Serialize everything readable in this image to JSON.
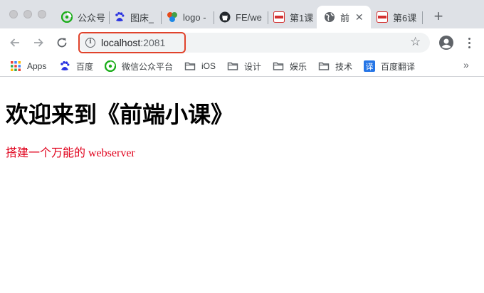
{
  "browser": {
    "tabs": [
      {
        "title": "公众号",
        "favicon": "wechat-icon"
      },
      {
        "title": "图床_",
        "favicon": "baidu-paw-icon"
      },
      {
        "title": "logo -",
        "favicon": "colorful-logo-icon"
      },
      {
        "title": "FE/we",
        "favicon": "github-icon"
      },
      {
        "title": "第1课",
        "favicon": "wii-icon"
      },
      {
        "title": "前端",
        "favicon": "globe-icon",
        "active": true
      },
      {
        "title": "第6课",
        "favicon": "wii-icon"
      }
    ],
    "new_tab_label": "+",
    "tab_close_label": "✕"
  },
  "toolbar": {
    "url_host": "localhost",
    "url_port": ":2081",
    "highlight_color": "#e0432c"
  },
  "bookmarks": [
    {
      "label": "Apps",
      "icon": "apps-grid-icon"
    },
    {
      "label": "百度",
      "icon": "baidu-paw-icon"
    },
    {
      "label": "微信公众平台",
      "icon": "wechat-icon"
    },
    {
      "label": "iOS",
      "icon": "folder-icon"
    },
    {
      "label": "设计",
      "icon": "folder-icon"
    },
    {
      "label": "娱乐",
      "icon": "folder-icon"
    },
    {
      "label": "技术",
      "icon": "folder-icon"
    },
    {
      "label": "百度翻译",
      "icon": "translate-icon"
    }
  ],
  "bookmarks_more": "»",
  "page": {
    "heading": "欢迎来到《前端小课》",
    "paragraph": "搭建一个万能的 webserver",
    "paragraph_color": "#e0001b"
  }
}
